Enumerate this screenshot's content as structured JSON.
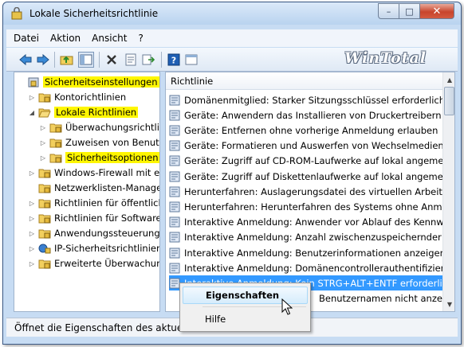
{
  "window": {
    "title": "Lokale Sicherheitsrichtlinie",
    "controls": {
      "minimize": "–",
      "maximize": "□",
      "close": "✕"
    }
  },
  "menubar": {
    "items": [
      "Datei",
      "Aktion",
      "Ansicht",
      "?"
    ]
  },
  "toolbar": {
    "icons": [
      "back-arrow-icon",
      "forward-arrow-icon",
      "up-folder-icon",
      "show-hide-tree-icon",
      "delete-icon",
      "properties-icon",
      "export-list-icon",
      "help-icon",
      "console-icon"
    ],
    "logo_text": "WinTotal"
  },
  "tree": {
    "items": [
      {
        "label": "Sicherheitseinstellungen",
        "highlighted": true,
        "indent": 0,
        "expander": "",
        "icon": "security-settings-icon"
      },
      {
        "label": "Kontorichtlinien",
        "highlighted": false,
        "indent": 1,
        "expander": "▷",
        "icon": "folder-icon"
      },
      {
        "label": "Lokale Richtlinien",
        "highlighted": true,
        "indent": 1,
        "expander": "◢",
        "icon": "folder-open-icon"
      },
      {
        "label": "Überwachungsrichtlin",
        "highlighted": false,
        "indent": 2,
        "expander": "▷",
        "icon": "folder-icon"
      },
      {
        "label": "Zuweisen von Benutze",
        "highlighted": false,
        "indent": 2,
        "expander": "▷",
        "icon": "folder-icon"
      },
      {
        "label": "Sicherheitsoptionen",
        "highlighted": true,
        "indent": 2,
        "expander": "▷",
        "icon": "folder-icon"
      },
      {
        "label": "Windows-Firewall mit erw",
        "highlighted": false,
        "indent": 1,
        "expander": "▷",
        "icon": "folder-icon"
      },
      {
        "label": "Netzwerklisten-Manager-",
        "highlighted": false,
        "indent": 1,
        "expander": "",
        "icon": "folder-icon"
      },
      {
        "label": "Richtlinien für öffentliche",
        "highlighted": false,
        "indent": 1,
        "expander": "▷",
        "icon": "folder-icon"
      },
      {
        "label": "Richtlinien für Softwareei",
        "highlighted": false,
        "indent": 1,
        "expander": "▷",
        "icon": "folder-icon"
      },
      {
        "label": "Anwendungssteuerungsri",
        "highlighted": false,
        "indent": 1,
        "expander": "▷",
        "icon": "folder-icon"
      },
      {
        "label": "IP-Sicherheitsrichtlinien a",
        "highlighted": false,
        "indent": 1,
        "expander": "▷",
        "icon": "ip-security-icon"
      },
      {
        "label": "Erweiterte Überwachungs",
        "highlighted": false,
        "indent": 1,
        "expander": "▷",
        "icon": "folder-icon"
      }
    ]
  },
  "list": {
    "column_header": "Richtlinie",
    "rows": [
      {
        "text": "Domänenmitglied: Starker Sitzungsschlüssel erforderlich (Wir",
        "selected": false
      },
      {
        "text": "Geräte: Anwendern das Installieren von Druckertreibern nicht",
        "selected": false
      },
      {
        "text": "Geräte: Entfernen ohne vorherige Anmeldung erlauben",
        "selected": false
      },
      {
        "text": "Geräte: Formatieren und Auswerfen von Wechselmedien zula",
        "selected": false
      },
      {
        "text": "Geräte: Zugriff auf CD-ROM-Laufwerke auf lokal angemeldet",
        "selected": false
      },
      {
        "text": "Geräte: Zugriff auf Diskettenlaufwerke auf lokal angemeldete",
        "selected": false
      },
      {
        "text": "Herunterfahren: Auslagerungsdatei des virtuellen Arbeitspeic",
        "selected": false
      },
      {
        "text": "Herunterfahren: Herunterfahren des Systems ohne Anmeldung",
        "selected": false
      },
      {
        "text": "Interaktive Anmeldung: Anwender vor Ablauf des Kennworts",
        "selected": false
      },
      {
        "text": "Interaktive Anmeldung: Anzahl zwischenzuspeichernder vorh",
        "selected": false
      },
      {
        "text": "Interaktive Anmeldung: Benutzerinformationen anzeigen, we",
        "selected": false
      },
      {
        "text": "Interaktive Anmeldung: Domänencontrollerauthentifizierung",
        "selected": false
      },
      {
        "text": "Interaktive Anmeldung: Kein STRG+ALT+ENTF erforderlich",
        "selected": true
      },
      {
        "text": "Benutzernamen nicht anzeige",
        "selected": false
      }
    ]
  },
  "context_menu": {
    "items": [
      "Eigenschaften",
      "Hilfe"
    ]
  },
  "statusbar": {
    "text": "Öffnet die Eigenschaften des aktuellen"
  },
  "colors": {
    "highlight_yellow": "#fff600",
    "selection_blue": "#3399ff",
    "window_frame": "#c7dcf3"
  }
}
